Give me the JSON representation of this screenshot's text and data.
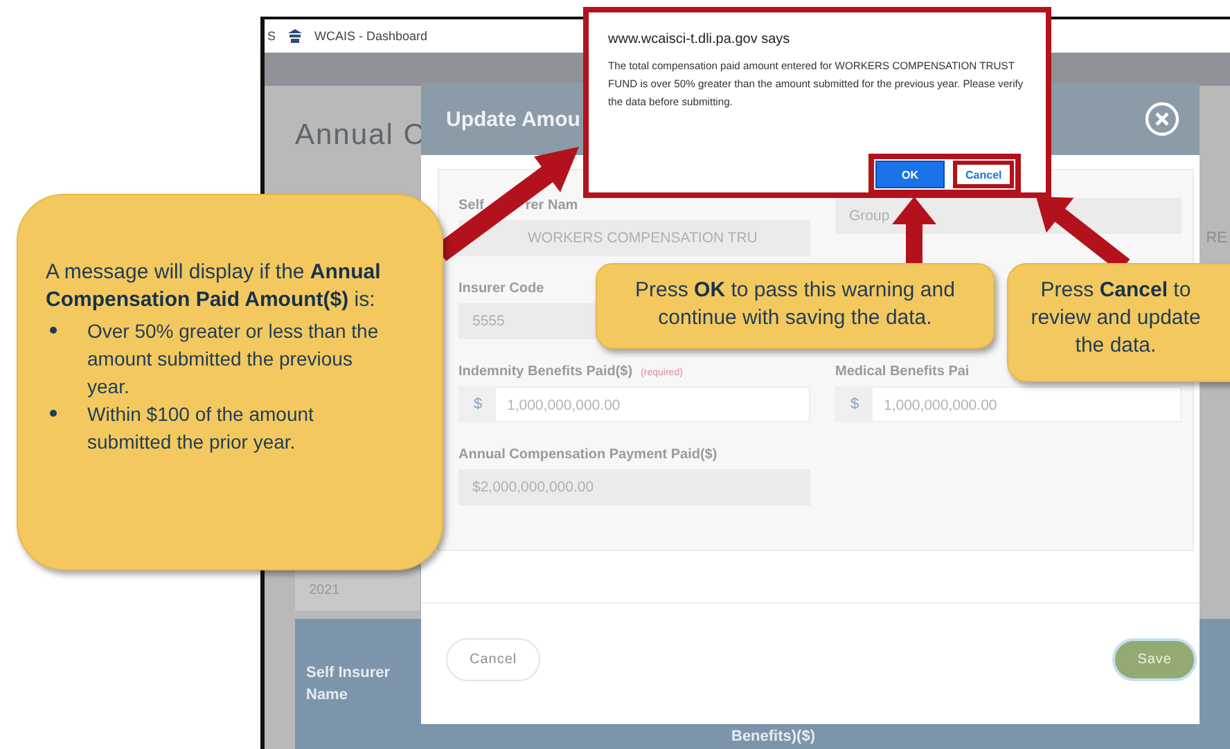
{
  "browser_tab": {
    "cut_label": "S",
    "title": "WCAIS - Dashboard"
  },
  "page": {
    "title": "Annual C",
    "side_text": "RE",
    "year": "2021",
    "table_columns": [
      "Self Insurer Name",
      "Benefits)($)"
    ]
  },
  "modal": {
    "title": "Update Amou",
    "rows": [
      [
        {
          "kind": "readonly",
          "label": "Self",
          "label_tail": "rer Nam",
          "value": "WORKERS COMPENSATION TRU"
        },
        {
          "kind": "readonly",
          "value": "Group"
        }
      ],
      [
        {
          "kind": "readonly",
          "label": "Insurer Code",
          "value": "5555"
        }
      ],
      [
        {
          "kind": "currency",
          "label": "Indemnity Benefits Paid($)",
          "required_note": "(required)",
          "prefix": "$",
          "value": "1,000,000,000.00"
        },
        {
          "kind": "currency",
          "label": "Medical Benefits Pai",
          "prefix": "$",
          "value": "1,000,000,000.00"
        }
      ],
      [
        {
          "kind": "readonly",
          "label": "Annual Compensation Payment Paid($)",
          "value": "$2,000,000,000.00"
        }
      ]
    ],
    "buttons": [
      {
        "kind": "secondary",
        "label": "Cancel"
      },
      {
        "kind": "primary",
        "label": "Save"
      }
    ]
  },
  "alert": {
    "origin": "www.wcaisci-t.dli.pa.gov says",
    "message": "The total compensation paid amount entered for WORKERS COMPENSATION TRUST FUND is over 50% greater than the amount submitted for the previous year. Please verify the data before submitting.",
    "buttons": [
      {
        "kind": "primary",
        "label": "OK"
      },
      {
        "kind": "secondary",
        "label": "Cancel"
      }
    ]
  },
  "callouts": [
    {
      "kind": "list",
      "text": "A message will display if the **Annual Compensation Paid Amount($)** is:",
      "bullets": [
        "Over 50% greater or less than the amount submitted the previous year.",
        "Within $100 of the amount submitted the prior year."
      ]
    },
    {
      "kind": "ok",
      "text": "Press **OK** to pass this warning and continue with saving the data."
    },
    {
      "kind": "cancel",
      "text": "Press **Cancel** to review and update the data."
    }
  ]
}
